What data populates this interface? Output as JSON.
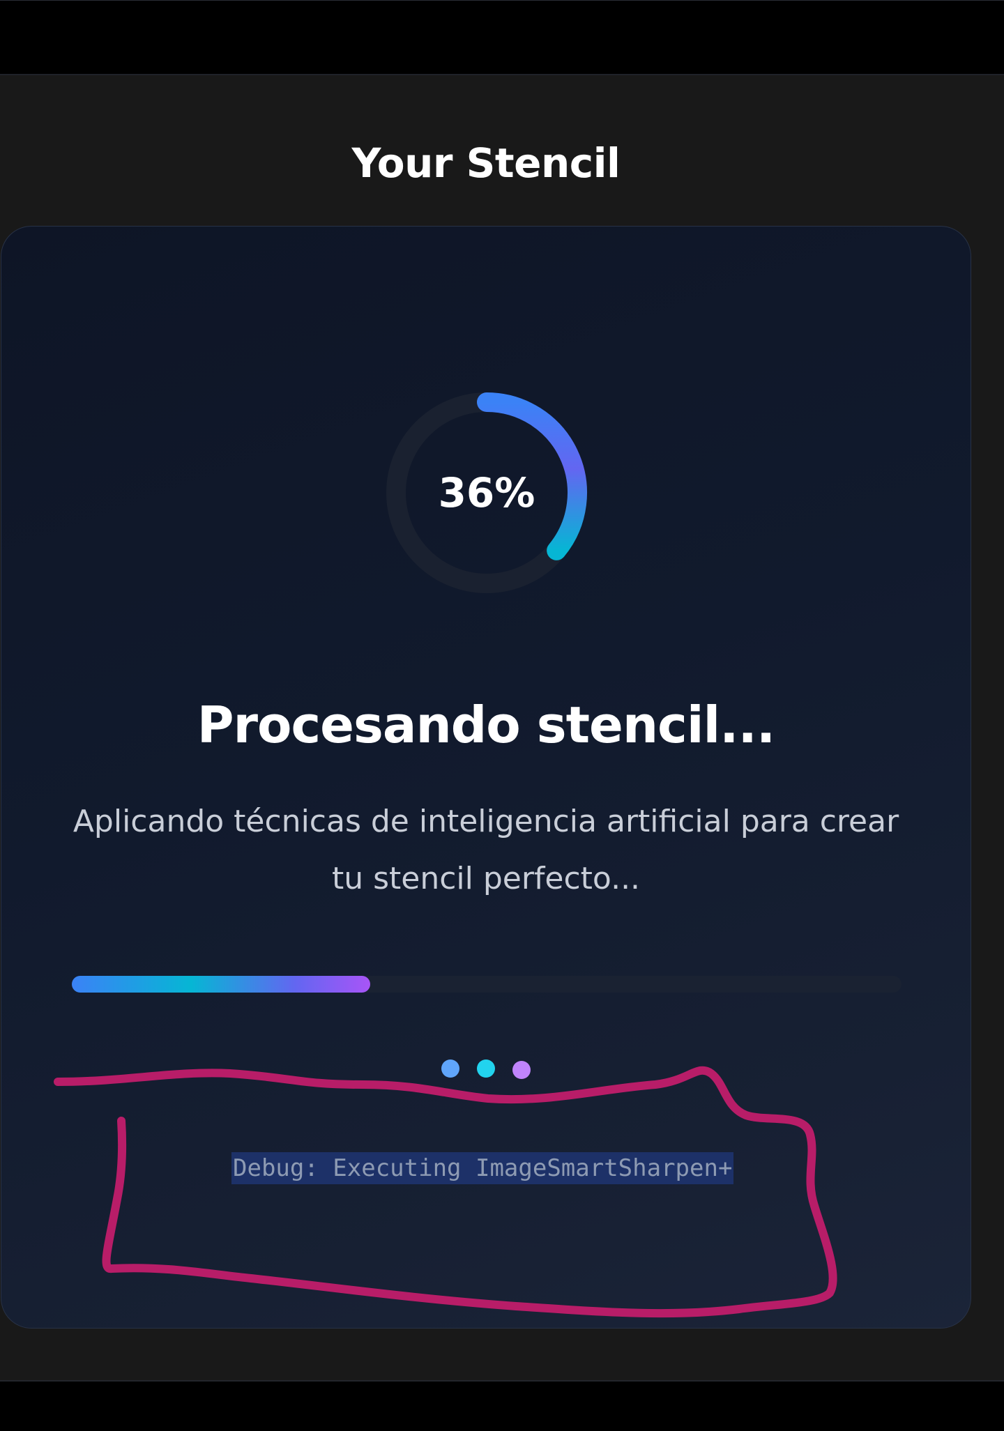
{
  "page": {
    "section_title": "Your Stencil"
  },
  "loader": {
    "progress_percent": 36,
    "percent_label": "36%",
    "heading": "Procesando stencil...",
    "subtext": "Aplicando técnicas de inteligencia artificial para crear tu stencil perfecto...",
    "bar_progress_fraction": 0.36,
    "debug_text": "Debug: Executing ImageSmartSharpen+"
  },
  "colors": {
    "ring_start": "#3b82f6",
    "ring_mid": "#6366f1",
    "ring_end": "#06b6d4",
    "ring_track": "#1a2130",
    "dot_1": "#60a5fa",
    "dot_2": "#22d3ee",
    "dot_3": "#c084fc",
    "annotation": "#b81d68"
  },
  "icons": {
    "loading_dots": "loading-dots-icon",
    "progress_ring": "progress-ring-icon"
  }
}
